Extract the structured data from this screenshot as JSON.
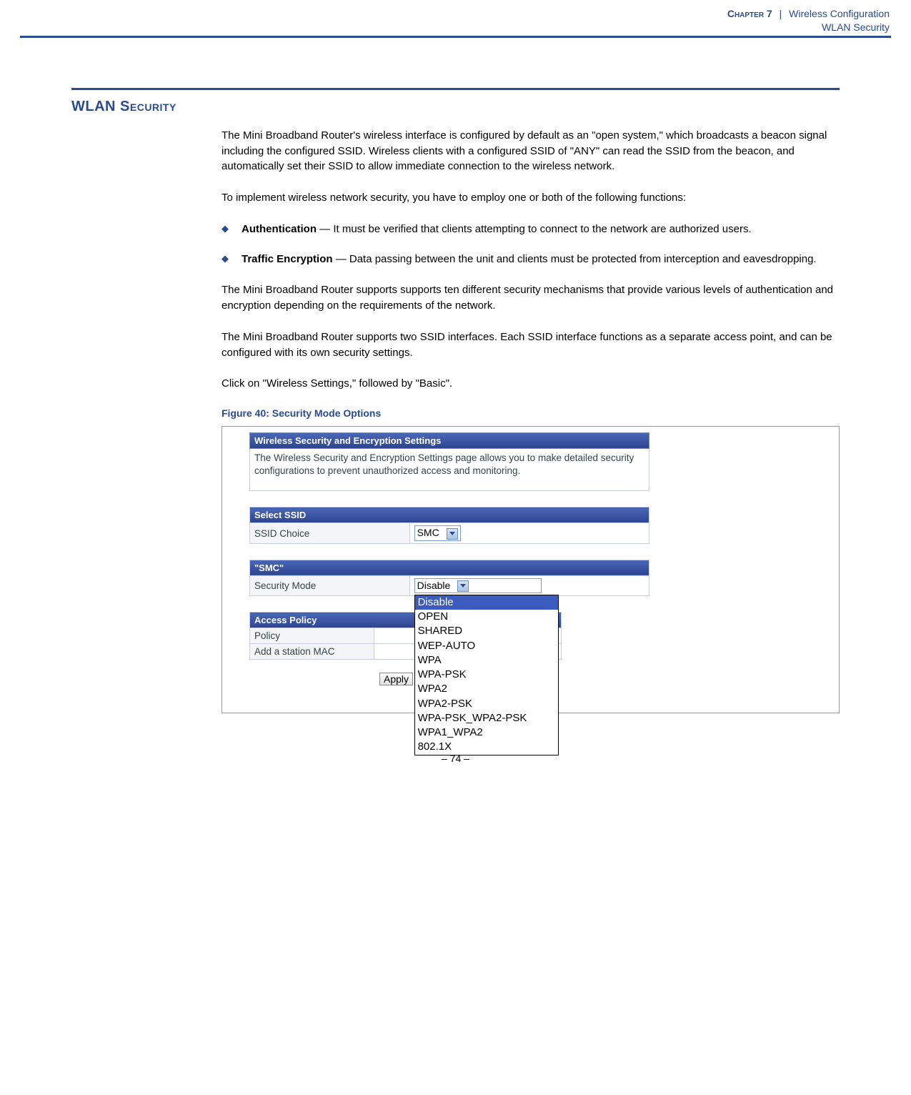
{
  "header": {
    "chapter": "Chapter 7",
    "separator": "|",
    "title": "Wireless Configuration",
    "subtitle": "WLAN Security"
  },
  "section_title": "WLAN Security",
  "paragraphs": {
    "p1": "The Mini Broadband Router's wireless interface is configured by default as an \"open system,\" which broadcasts a beacon signal including the configured SSID. Wireless clients with a configured SSID of \"ANY\" can read the SSID from the beacon, and automatically set their SSID to allow immediate connection to the wireless network.",
    "p2": "To implement wireless network security, you have to employ one or both of the following functions:",
    "p3": "The Mini Broadband Router supports supports ten different security mechanisms that provide various levels of authentication and encryption depending on the requirements of the network.",
    "p4": "The Mini Broadband Router supports two SSID interfaces. Each SSID interface functions as a separate access point, and can be configured with its own security settings.",
    "p5": "Click on \"Wireless Settings,\" followed by \"Basic\"."
  },
  "bullets": {
    "b1_strong": "Authentication",
    "b1_rest": " — It must be verified that clients attempting to connect to the network are authorized users.",
    "b2_strong": "Traffic Encryption",
    "b2_rest": " — Data passing between the unit and clients must be protected from interception and eavesdropping."
  },
  "figure": {
    "caption": "Figure 40:  Security Mode Options",
    "panel1_header": "Wireless Security and Encryption Settings",
    "panel1_desc": "The Wireless Security and Encryption Settings page allows you to make detailed security configurations to prevent unauthorized access and monitoring.",
    "panel2_header": "Select SSID",
    "ssid_label": "SSID Choice",
    "ssid_value": "SMC",
    "panel3_header": "\"SMC\"",
    "mode_label": "Security Mode",
    "mode_value": "Disable",
    "mode_options": [
      "Disable",
      "OPEN",
      "SHARED",
      "WEP-AUTO",
      "WPA",
      "WPA-PSK",
      "WPA2",
      "WPA2-PSK",
      "WPA-PSK_WPA2-PSK",
      "WPA1_WPA2",
      "802.1X"
    ],
    "panel4_header": "Access Policy",
    "policy_label": "Policy",
    "mac_label": "Add a station MAC",
    "apply_label": "Apply"
  },
  "footer": "–  74  –"
}
